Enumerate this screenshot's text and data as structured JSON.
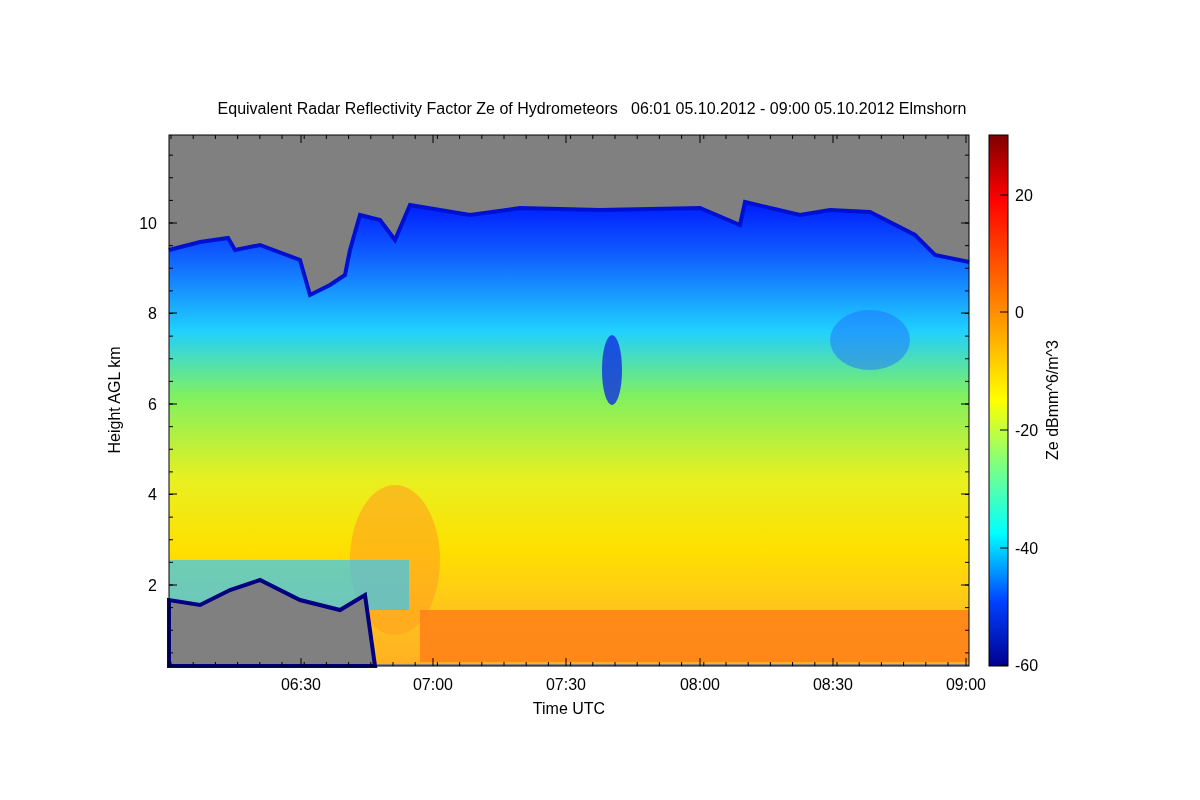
{
  "chart": {
    "title": "Equivalent Radar Reflectivity Factor Ze of Hydrometeors   06:01 05.10.2012 - 09:00 05.10.2012 Elmshorn",
    "xlabel": "Time UTC",
    "ylabel": "Height AGL km",
    "xticks": [
      "06:30",
      "07:00",
      "07:30",
      "08:00",
      "08:30",
      "09:00"
    ],
    "yticks": [
      "10",
      "8",
      "6",
      "4",
      "2"
    ]
  },
  "colorbar": {
    "label": "Ze dBmm^6/m^3",
    "ticks": [
      "20",
      "0",
      "-20",
      "-40",
      "-60"
    ]
  }
}
